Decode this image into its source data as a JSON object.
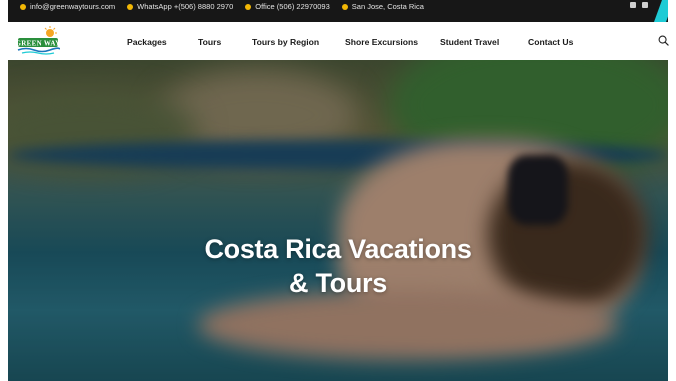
{
  "topbar": {
    "items": [
      {
        "icon": "mail-icon",
        "text": "info@greenwaytours.com"
      },
      {
        "icon": "whatsapp-icon",
        "text": "WhatsApp +(506) 8880 2970"
      },
      {
        "icon": "phone-icon",
        "text": "Office (506) 22970093"
      },
      {
        "icon": "location-icon",
        "text": "San Jose, Costa Rica"
      }
    ]
  },
  "nav": {
    "logo_alt": "Green Way Costa Rica",
    "menu": [
      "Packages",
      "Tours",
      "Tours by Region",
      "Shore Excursions",
      "Student Travel",
      "Contact Us"
    ]
  },
  "hero": {
    "title_line1": "Costa Rica Vacations",
    "title_line2": "& Tours"
  },
  "colors": {
    "topbar_bg": "#171717",
    "accent": "#1ecbd5",
    "icon": "#f2b705"
  }
}
